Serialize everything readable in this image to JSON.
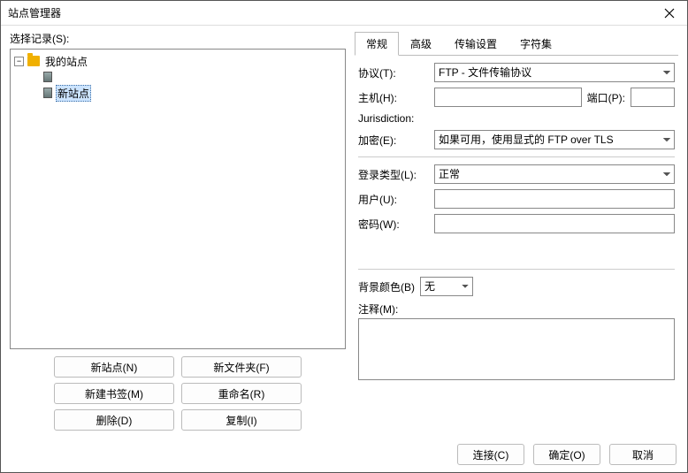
{
  "window": {
    "title": "站点管理器"
  },
  "left": {
    "select_label": "选择记录(S):",
    "tree": {
      "root": {
        "label": "我的站点"
      },
      "child1": {
        "label": ""
      },
      "child2": {
        "label": "新站点"
      }
    },
    "buttons": {
      "new_site": "新站点(N)",
      "new_folder": "新文件夹(F)",
      "new_bookmark": "新建书签(M)",
      "rename": "重命名(R)",
      "delete": "删除(D)",
      "copy": "复制(I)"
    }
  },
  "tabs": {
    "general": "常规",
    "advanced": "高级",
    "transfer": "传输设置",
    "charset": "字符集"
  },
  "form": {
    "protocol_label": "协议(T):",
    "protocol_value": "FTP - 文件传输协议",
    "host_label": "主机(H):",
    "host_value": "",
    "port_label": "端口(P):",
    "port_value": "",
    "jurisdiction_label": "Jurisdiction:",
    "encryption_label": "加密(E):",
    "encryption_value": "如果可用，使用显式的 FTP over TLS",
    "logon_type_label": "登录类型(L):",
    "logon_type_value": "正常",
    "user_label": "用户(U):",
    "user_value": "",
    "password_label": "密码(W):",
    "password_value": "",
    "bgcolor_label": "背景颜色(B)",
    "bgcolor_value": "无",
    "comment_label": "注释(M):",
    "comment_value": ""
  },
  "footer": {
    "connect": "连接(C)",
    "ok": "确定(O)",
    "cancel": "取消"
  }
}
